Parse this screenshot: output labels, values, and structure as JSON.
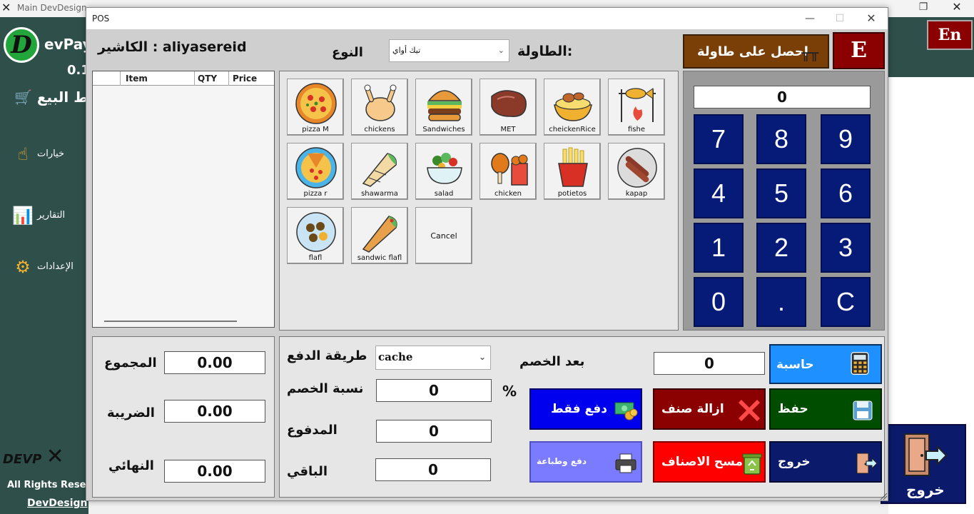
{
  "main_window": {
    "title": "Main DevDesign",
    "sidebar": {
      "logo_letter": "D",
      "brand": "evPay",
      "version": "0.1",
      "pos_label": "ط البيع",
      "nav": [
        {
          "label": "خيارات",
          "icon": "hand-sliders-icon"
        },
        {
          "label": "التقارير",
          "icon": "report-chart-icon"
        },
        {
          "label": "الإعدادات",
          "icon": "gear-icon"
        }
      ],
      "footer_logo": "DEVP",
      "rights": "All Rights Reser",
      "devdesign": "DevDesign"
    },
    "en_label": "En",
    "exit_label": "خروج"
  },
  "pos": {
    "title": "POS",
    "cashier": "الكاشير : aliyasereid",
    "type_label": "النوع",
    "type_value": "تيك أواي",
    "table_label": "الطاولة:",
    "get_table_label": "احصل على طاولة",
    "e_label": "E",
    "order_columns": [
      "Item",
      "QTY",
      "Price"
    ],
    "foods": [
      {
        "label": "pizza M",
        "icon": "pizza-icon"
      },
      {
        "label": "chickens",
        "icon": "roast-chicken-icon"
      },
      {
        "label": "Sandwiches",
        "icon": "burger-icon"
      },
      {
        "label": "MET",
        "icon": "steak-icon"
      },
      {
        "label": "cheickenRice",
        "icon": "chicken-rice-icon"
      },
      {
        "label": "fishe",
        "icon": "grilled-fish-icon"
      },
      {
        "label": "pizza r",
        "icon": "pizza-round-icon"
      },
      {
        "label": "shawarma",
        "icon": "shawarma-icon"
      },
      {
        "label": "salad",
        "icon": "salad-icon"
      },
      {
        "label": "chicken",
        "icon": "fried-chicken-icon"
      },
      {
        "label": "potietos",
        "icon": "fries-icon"
      },
      {
        "label": "kapap",
        "icon": "kebab-icon"
      },
      {
        "label": "flafl",
        "icon": "falafel-icon"
      },
      {
        "label": "sandwic flafl",
        "icon": "wrap-icon"
      },
      {
        "label": "Cancel",
        "icon": ""
      }
    ],
    "keypad": {
      "display": "0",
      "keys": [
        "7",
        "8",
        "9",
        "4",
        "5",
        "6",
        "1",
        "2",
        "3",
        "0",
        ".",
        "C"
      ]
    },
    "totals": {
      "total_label": "المجموع",
      "total_value": "0.00",
      "tax_label": "الضريبة",
      "tax_value": "0.00",
      "final_label": "النهائي",
      "final_value": "0.00"
    },
    "payment": {
      "method_label": "طريقة الدفع",
      "method_value": "cache",
      "discount_pct_label": "نسبة الخصم",
      "discount_pct_value": "0",
      "percent_sign": "%",
      "paid_label": "المدفوع",
      "paid_value": "0",
      "remaining_label": "الباقي",
      "remaining_value": "0",
      "after_discount_label": "بعد الخصم",
      "after_discount_value": "0"
    },
    "actions": {
      "calculator": "حاسبة",
      "pay_only": "دفع فقط",
      "remove_item": "ازالة صنف",
      "save": "حفظ",
      "pay_print": "دفع وطباعة",
      "clear_items": "مسح الاصناف",
      "exit": "خروج"
    },
    "colors": {
      "key_blue": "#061a78",
      "pay_only": "#0000ee",
      "remove_item": "#8b0000",
      "save": "#004d00",
      "pay_print": "#7b7bff",
      "clear_items": "#ff0000",
      "exit": "#0b1a6b",
      "calculator": "#1e90ff"
    }
  }
}
